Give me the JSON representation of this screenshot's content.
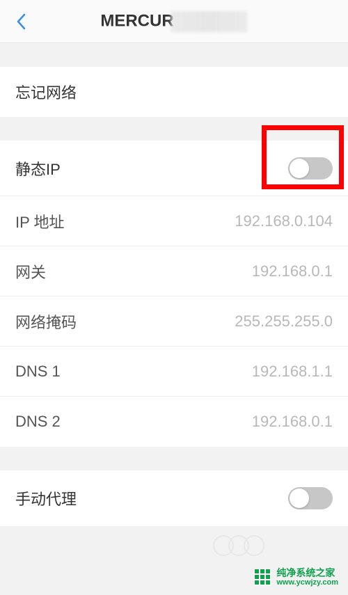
{
  "header": {
    "title_visible": "MERCUR"
  },
  "sections": {
    "forget_network": "忘记网络",
    "static_ip": {
      "label": "静态IP",
      "rows": {
        "ip_address": {
          "label": "IP 地址",
          "value": "192.168.0.104"
        },
        "gateway": {
          "label": "网关",
          "value": "192.168.0.1"
        },
        "netmask": {
          "label": "网络掩码",
          "value": "255.255.255.0"
        },
        "dns1": {
          "label": "DNS 1",
          "value": "192.168.1.1"
        },
        "dns2": {
          "label": "DNS 2",
          "value": "192.168.0.1"
        }
      }
    },
    "manual_proxy": "手动代理"
  },
  "watermark": {
    "line1": "纯净系统之家",
    "line2": "www.ycwjzy.com"
  }
}
